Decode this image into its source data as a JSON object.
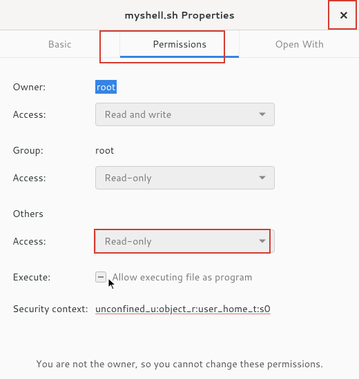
{
  "window": {
    "title": "myshell.sh Properties"
  },
  "tabs": {
    "basic": "Basic",
    "permissions": "Permissions",
    "open_with": "Open With",
    "active": "permissions"
  },
  "labels": {
    "owner": "Owner:",
    "access": "Access:",
    "group": "Group:",
    "others": "Others",
    "execute": "Execute:",
    "security_context": "Security context:"
  },
  "owner": {
    "value": "root",
    "access": "Read and write"
  },
  "group": {
    "value": "root",
    "access": "Read-only"
  },
  "others": {
    "access": "Read-only"
  },
  "execute": {
    "checkbox_label": "Allow executing file as program",
    "state": "mixed"
  },
  "security_context": "unconfined_u:object_r:user_home_t:s0",
  "footer": "You are not the owner, so you cannot change these permissions.",
  "icons": {
    "close": "✕"
  }
}
